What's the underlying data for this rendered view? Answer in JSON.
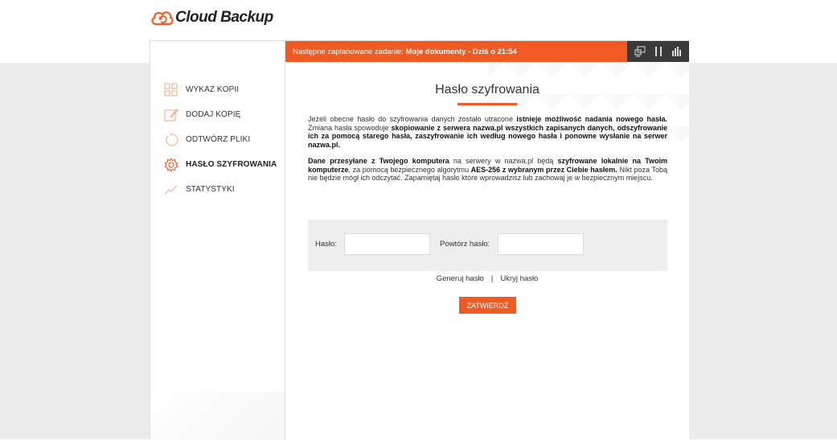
{
  "brand": {
    "name": "Cloud Backup",
    "accent": "#f15a22"
  },
  "sidebar": {
    "items": [
      {
        "label": "WYKAZ KOPII",
        "icon": "grid-icon",
        "active": false
      },
      {
        "label": "DODAJ KOPIĘ",
        "icon": "edit-icon",
        "active": false
      },
      {
        "label": "ODTWÓRZ PLIKI",
        "icon": "restore-icon",
        "active": false
      },
      {
        "label": "HASŁO SZYFROWANIA",
        "icon": "gear-icon",
        "active": true
      },
      {
        "label": "STATYSTYKI",
        "icon": "chart-line-icon",
        "active": false
      }
    ]
  },
  "topbar": {
    "prefix": "Następne zaplanowane zadanie: ",
    "task": "Moje dokumenty - Dziś o 21:54",
    "tools": [
      "monitor-icon",
      "pause-icon",
      "bar-chart-icon"
    ]
  },
  "main": {
    "title": "Hasło szyfrowania",
    "para1": {
      "t1": "Jeżeli obecne hasło do szyfrowania danych zostało utracone ",
      "b1": "istnieje możliwość nadania nowego hasła.",
      "t2": " Zmiana hasła spowoduje ",
      "b2": "skopiowanie z serwera nazwa.pl wszystkich zapisanych danych, odszyfrowanie ich za pomocą starego hasła, zaszyfrowanie ich według nowego hasła i ponowne wysłanie na serwer nazwa.pl."
    },
    "para2": {
      "b1": "Dane przesyłane z Twojego komputera",
      "t1": " na serwery w nazwa.pl będą ",
      "b2": "szyfrowane lokalnie na Twoim komputerze",
      "t2": ", za pomocą bezpiecznego algorytmu ",
      "b3": "AES-256 z wybranym przez Ciebie hasłem.",
      "t3": " Nikt poza Tobą nie będzie mógł ich odczytać. Zapamiętaj hasło które wprowadzisz lub zachowaj je w bezpiecznym miejscu."
    },
    "form": {
      "password_label": "Hasło:",
      "password_value": "",
      "repeat_label": "Powtórz hasło:",
      "repeat_value": ""
    },
    "links": {
      "generate": "Generuj hasło",
      "separator": "|",
      "hide": "Ukryj hasło"
    },
    "submit_label": "ZATWIERDŹ"
  }
}
